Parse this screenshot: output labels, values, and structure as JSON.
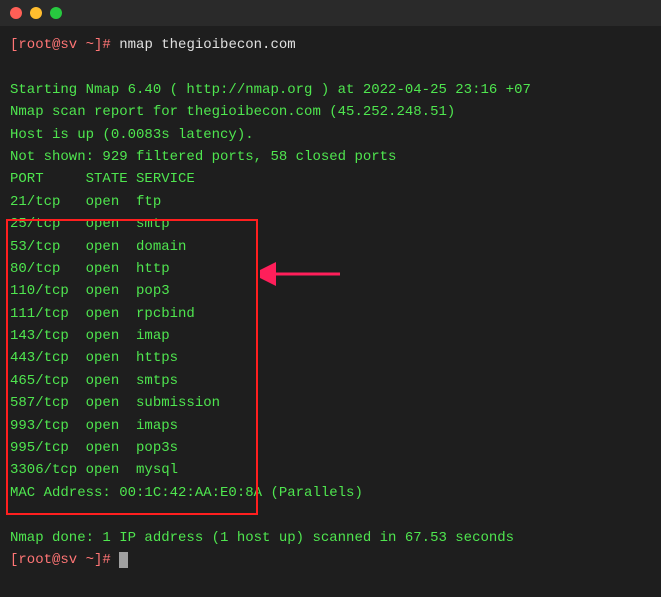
{
  "prompt": {
    "user_host": "[root@sv ~]#",
    "command": "nmap thegioibecon.com"
  },
  "output": {
    "starting": "Starting Nmap 6.40 ( http://nmap.org ) at 2022-04-25 23:16 +07",
    "scan_report": "Nmap scan report for thegioibecon.com (45.252.248.51)",
    "host_up": "Host is up (0.0083s latency).",
    "not_shown": "Not shown: 929 filtered ports, 58 closed ports",
    "header": "PORT     STATE SERVICE",
    "ports": [
      "21/tcp   open  ftp",
      "25/tcp   open  smtp",
      "53/tcp   open  domain",
      "80/tcp   open  http",
      "110/tcp  open  pop3",
      "111/tcp  open  rpcbind",
      "143/tcp  open  imap",
      "443/tcp  open  https",
      "465/tcp  open  smtps",
      "587/tcp  open  submission",
      "993/tcp  open  imaps",
      "995/tcp  open  pop3s",
      "3306/tcp open  mysql"
    ],
    "mac": "MAC Address: 00:1C:42:AA:E0:8A (Parallels)",
    "done": "Nmap done: 1 IP address (1 host up) scanned in 67.53 seconds"
  },
  "prompt2": {
    "user_host": "[root@sv ~]#"
  }
}
